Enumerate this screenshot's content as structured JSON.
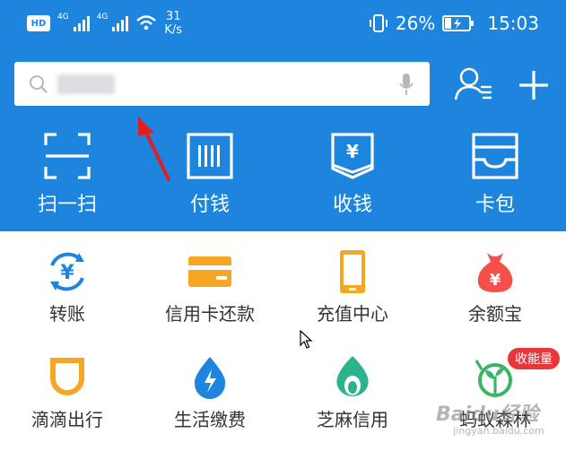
{
  "status_bar": {
    "network_left": "4G",
    "network_right": "4G",
    "speed_value": "31",
    "speed_unit": "K/s",
    "battery": "26%",
    "time": "15:03"
  },
  "search": {
    "placeholder": ""
  },
  "colors": {
    "brand_blue": "#1d85de",
    "badge_red": "#e8373b",
    "annotation_red": "#e02020"
  },
  "main_actions": [
    {
      "label": "扫一扫",
      "icon": "scan-icon"
    },
    {
      "label": "付钱",
      "icon": "pay-barcode-icon"
    },
    {
      "label": "收钱",
      "icon": "receive-money-icon"
    },
    {
      "label": "卡包",
      "icon": "card-wallet-icon"
    }
  ],
  "grid": [
    {
      "label": "转账",
      "icon": "transfer-yuan-icon"
    },
    {
      "label": "信用卡还款",
      "icon": "credit-card-icon"
    },
    {
      "label": "充值中心",
      "icon": "phone-recharge-icon"
    },
    {
      "label": "余额宝",
      "icon": "money-bag-icon"
    },
    {
      "label": "滴滴出行",
      "icon": "didi-icon"
    },
    {
      "label": "生活缴费",
      "icon": "utility-drop-icon"
    },
    {
      "label": "芝麻信用",
      "icon": "sesame-credit-icon"
    },
    {
      "label": "蚂蚁森林",
      "icon": "ant-forest-icon"
    }
  ],
  "forest_badge": "收能量",
  "watermark": {
    "main": "Baidu经验",
    "sub": "jingyan.baidu.com"
  }
}
